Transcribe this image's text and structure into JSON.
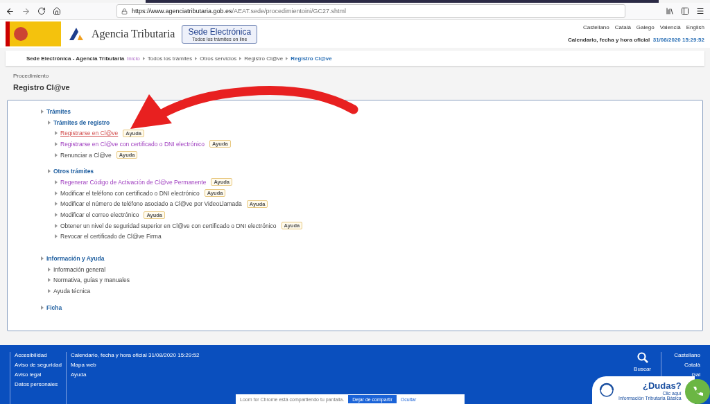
{
  "browser": {
    "url_host": "https://www.agenciatributaria.gob.es",
    "url_path": "/AEAT.sede/procedimientoini/GC27.shtml"
  },
  "header": {
    "logo_text": "Agencia Tributaria",
    "sede_title": "Sede Electrónica",
    "sede_subtitle": "Todos los trámites on line",
    "languages": [
      "Castellano",
      "Català",
      "Galego",
      "Valencià",
      "English"
    ],
    "clock_label": "Calendario, fecha y hora oficial",
    "clock_value": "31/08/2020 15:29:52"
  },
  "breadcrumb": {
    "site": "Sede Electrónica - Agencia Tributaria",
    "items": [
      {
        "label": "Inicio",
        "kind": "visited"
      },
      {
        "label": "Todos los trámites",
        "kind": "normal"
      },
      {
        "label": "Otros servicios",
        "kind": "normal"
      },
      {
        "label": "Registro Cl@ve",
        "kind": "normal"
      },
      {
        "label": "Registro Cl@ve",
        "kind": "current"
      }
    ]
  },
  "page": {
    "kicker": "Procedimiento",
    "title": "Registro Cl@ve"
  },
  "tree": [
    {
      "label": "Trámites",
      "kind": "section",
      "children": [
        {
          "label": "Trámites de registro",
          "kind": "section",
          "children": [
            {
              "label": "Registrarse en Cl@ve",
              "kind": "hover",
              "help": "Ayuda"
            },
            {
              "label": "Registrarse en Cl@ve con certificado o DNI electrónico",
              "kind": "visited",
              "help": "Ayuda"
            },
            {
              "label": "Renunciar a Cl@ve",
              "kind": "normal",
              "help": "Ayuda"
            }
          ]
        },
        {
          "label": "Otros trámites",
          "kind": "section",
          "children": [
            {
              "label": "Regenerar Código de Activación de Cl@ve Permanente",
              "kind": "visited",
              "help": "Ayuda"
            },
            {
              "label": "Modificar el teléfono con certificado o DNI electrónico",
              "kind": "normal",
              "help": "Ayuda"
            },
            {
              "label": "Modificar el número de teléfono asociado a Cl@ve por VideoLlamada",
              "kind": "normal",
              "help": "Ayuda"
            },
            {
              "label": "Modificar el correo electrónico",
              "kind": "normal",
              "help": "Ayuda"
            },
            {
              "label": "Obtener un nivel de seguridad superior en Cl@ve con certificado o DNI electrónico",
              "kind": "normal",
              "help": "Ayuda"
            },
            {
              "label": "Revocar el certificado de Cl@ve Firma",
              "kind": "normal"
            }
          ]
        }
      ]
    },
    {
      "label": "Información y Ayuda",
      "kind": "section",
      "children": [
        {
          "label": "Información general",
          "kind": "normal"
        },
        {
          "label": "Normativa, guías y manuales",
          "kind": "normal"
        },
        {
          "label": "Ayuda técnica",
          "kind": "normal"
        }
      ]
    },
    {
      "label": "Ficha",
      "kind": "section"
    }
  ],
  "footer": {
    "column_1": [
      "Accesibilidad",
      "Aviso de seguridad",
      "Aviso legal",
      "Datos personales"
    ],
    "column_2": [
      "Calendario, fecha y hora oficial 31/08/2020 15:29:52",
      "Mapa web",
      "Ayuda"
    ],
    "search_label": "Buscar",
    "languages": [
      "Castellano",
      "Català",
      "Gal"
    ]
  },
  "share_bar": {
    "message": "Loom for Chrome está compartiendo tu pantalla.",
    "stop_button": "Dejar de compartir",
    "hide_link": "Ocultar"
  },
  "help_widget": {
    "title": "¿Dudas?",
    "action": "Clic aquí",
    "caption": "Información Tributaria Básica"
  }
}
